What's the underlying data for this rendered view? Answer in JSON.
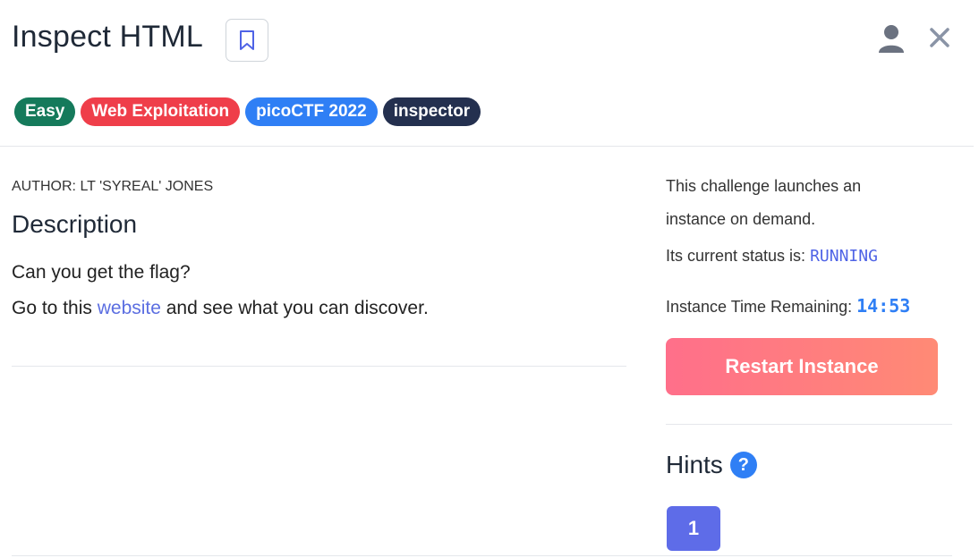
{
  "header": {
    "title": "Inspect HTML",
    "tags": [
      "Easy",
      "Web Exploitation",
      "picoCTF 2022",
      "inspector"
    ]
  },
  "main": {
    "author": "AUTHOR: LT 'SYREAL' JONES",
    "description_heading": "Description",
    "line1": "Can you get the flag?",
    "line2_prefix": "Go to this ",
    "line2_link": "website",
    "line2_suffix": " and see what you can discover."
  },
  "sidebar": {
    "launch_line1": "This challenge launches an",
    "launch_line2": "instance on demand.",
    "status_label": "Its current status is: ",
    "status_value": "RUNNING",
    "time_label": "Instance Time Remaining: ",
    "time_value": "14:53",
    "restart_label": "Restart Instance",
    "hints_heading": "Hints",
    "help_icon_glyph": "?",
    "hints": [
      "1"
    ]
  },
  "icons": [
    "bookmark-icon",
    "user-icon",
    "close-icon",
    "help-icon"
  ],
  "colors": {
    "easy": "#157a5b",
    "web": "#ef3e4a",
    "pico": "#2f7ff5",
    "inspector": "#24304f",
    "accent": "#5e6ce8",
    "restart": "#ff7a80"
  }
}
